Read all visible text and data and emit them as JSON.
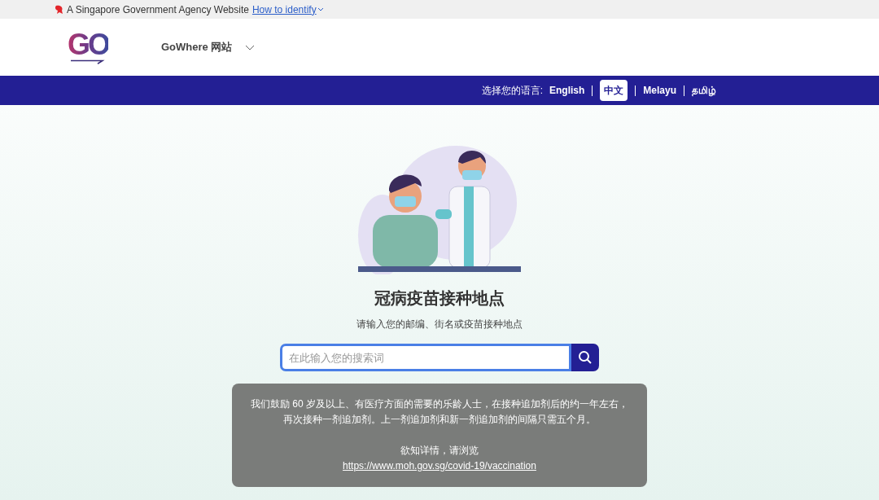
{
  "gov_banner": {
    "text": "A Singapore Government Agency Website",
    "link": "How to identify"
  },
  "header": {
    "logo": "GO",
    "site_menu": "GoWhere 网站"
  },
  "language_bar": {
    "label": "选择您的语言:",
    "languages": [
      {
        "label": "English",
        "selected": false
      },
      {
        "label": "中文",
        "selected": true
      },
      {
        "label": "Melayu",
        "selected": false
      },
      {
        "label": "தமிழ்",
        "selected": false
      }
    ]
  },
  "main": {
    "title": "冠病疫苗接种地点",
    "subtitle": "请输入您的邮编、街名或疫苗接种地点",
    "search": {
      "placeholder": "在此输入您的搜索词"
    },
    "notice": {
      "text": "我们鼓励 60 岁及以上、有医疗方面的需要的乐龄人士，在接种追加剂后的约一年左右，再次接种一剂追加剂。上一剂追加剂和新一剂追加剂的间隔只需五个月。",
      "more": "欲知详情，请浏览",
      "link": "https://www.moh.gov.sg/covid-19/vaccination"
    }
  }
}
